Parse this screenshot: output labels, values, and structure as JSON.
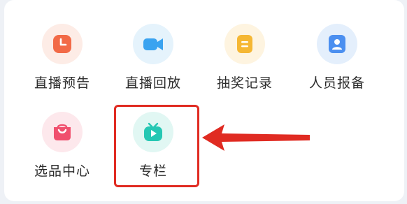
{
  "colors": {
    "card_bg": "#ffffff",
    "page_bg": "#eef1f6",
    "highlight": "#e02b22",
    "label_text": "#2c2c2c"
  },
  "grid": {
    "items": [
      {
        "label": "直播预告",
        "icon": "clock-icon",
        "bg": "#fdece6",
        "fg": "#f26a47"
      },
      {
        "label": "直播回放",
        "icon": "video-camera-icon",
        "bg": "#e5f3fc",
        "fg": "#3aa3f0"
      },
      {
        "label": "抽奖记录",
        "icon": "document-icon",
        "bg": "#fef4e0",
        "fg": "#f5b733"
      },
      {
        "label": "人员报备",
        "icon": "person-card-icon",
        "bg": "#e4effc",
        "fg": "#4b8ff0"
      },
      {
        "label": "选品中心",
        "icon": "shopping-bag-icon",
        "bg": "#fde8ec",
        "fg": "#f0506e"
      },
      {
        "label": "专栏",
        "icon": "tv-play-icon",
        "bg": "#e1f7f3",
        "fg": "#25c7b3"
      }
    ]
  }
}
